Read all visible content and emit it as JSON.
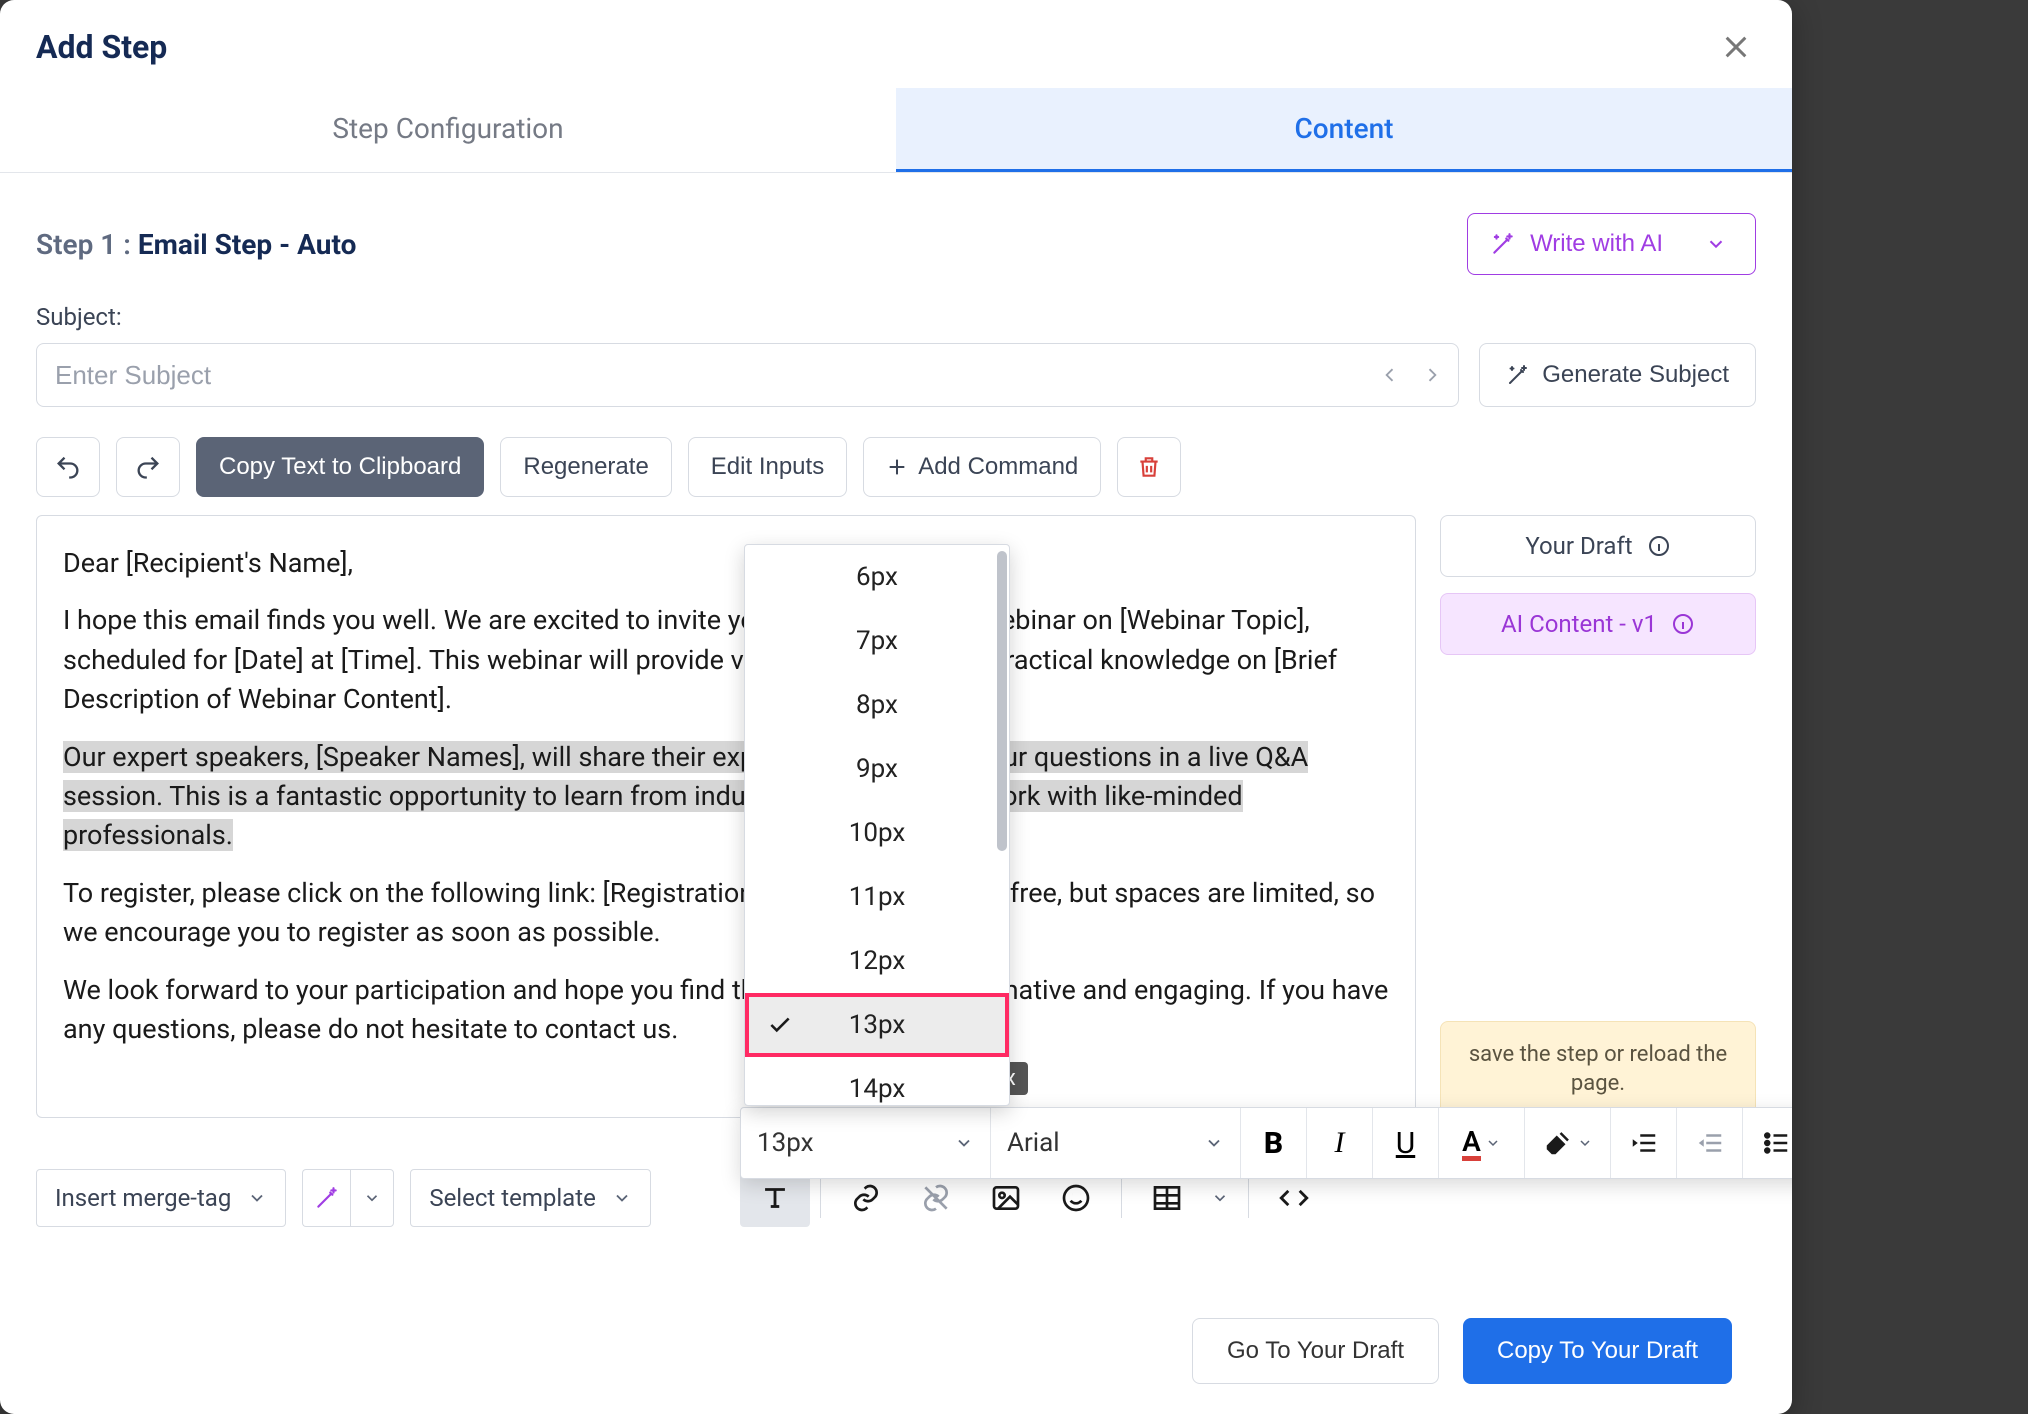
{
  "modal": {
    "title": "Add Step"
  },
  "tabs": {
    "config": "Step Configuration",
    "content": "Content",
    "active": "content"
  },
  "step": {
    "prefix": "Step 1 : ",
    "name": "Email Step - Auto"
  },
  "write_ai_label": "Write with AI",
  "subject": {
    "label": "Subject:",
    "value": "",
    "placeholder": "Enter Subject"
  },
  "gen_subject_label": "Generate Subject",
  "toolbar": {
    "copy": "Copy Text to Clipboard",
    "regen": "Regenerate",
    "edit_inputs": "Edit Inputs",
    "add_cmd": "Add Command"
  },
  "editor": {
    "p1": "Dear [Recipient's Name],",
    "p2": "I hope this email finds you well. We are excited to invite you to our upcoming webinar on [Webinar Topic], scheduled for [Date] at [Time]. This webinar will provide valuable insights and practical knowledge on [Brief Description of Webinar Content].",
    "p3": "Our expert speakers, [Speaker Names], will share their expertise and answer your questions in a live Q&A session. This is a fantastic opportunity to learn from industry leaders and network with like-minded professionals.",
    "p4": "To register, please click on the following link: [Registration Link]. Registration is free, but spaces are limited, so we encourage you to register as soon as possible.",
    "p5": "We look forward to your participation and hope you find the webinar both informative and engaging. If you have any questions, please do not hesitate to contact us."
  },
  "side": {
    "draft": "Your Draft",
    "ai": "AI Content - v1",
    "note": "save the step or reload the page."
  },
  "bottom": {
    "merge": "Insert merge-tag",
    "template": "Select template"
  },
  "fmt": {
    "size_current": "13px",
    "font_current": "Arial"
  },
  "size_menu": {
    "items": [
      "6px",
      "7px",
      "8px",
      "9px",
      "10px",
      "11px",
      "12px",
      "13px",
      "14px"
    ],
    "selected": "13px",
    "tooltip": "13px"
  },
  "footer": {
    "go_draft": "Go To Your Draft",
    "copy_draft": "Copy To Your Draft"
  }
}
